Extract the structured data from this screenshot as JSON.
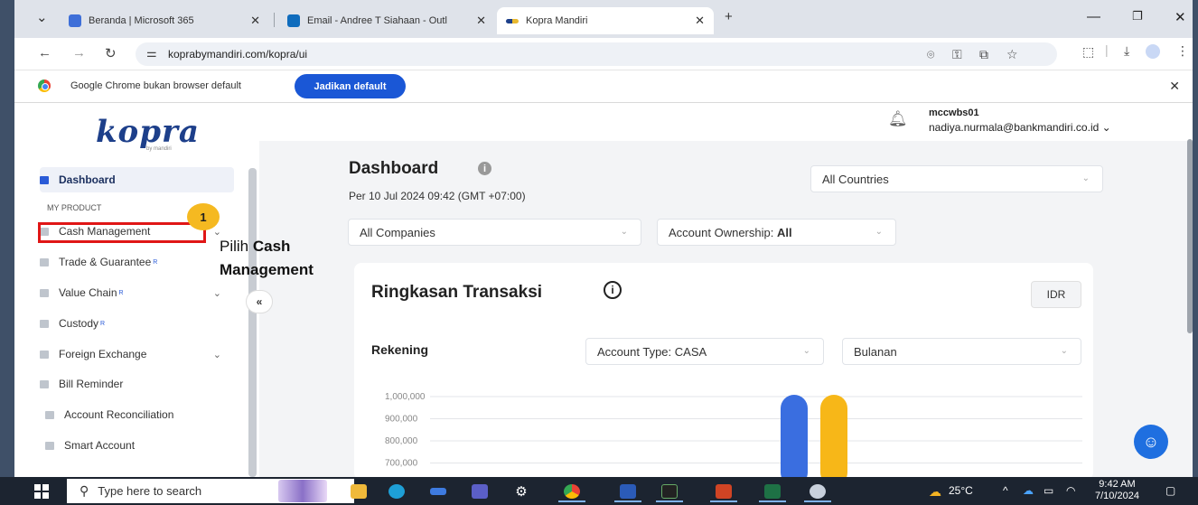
{
  "browser": {
    "tabs": [
      {
        "title": "Beranda | Microsoft 365",
        "icon": "microsoft-365-icon",
        "color": "#3e6fd8"
      },
      {
        "title": "Email - Andree T Siahaan - Outl",
        "icon": "outlook-icon",
        "color": "#0f6cbd"
      },
      {
        "title": "Kopra Mandiri",
        "icon": "kopra-favicon",
        "color": "#e8b830"
      }
    ],
    "url": "koprabymandiri.com/kopra/ui",
    "infobar_message": "Google Chrome bukan browser default",
    "infobar_button": "Jadikan default"
  },
  "app": {
    "logo": "kopra",
    "logo_sub": "by mandiri",
    "user": {
      "id": "mccwbs01",
      "email": "nadiya.nurmala@bankmandiri.co.id"
    },
    "sidebar": {
      "dashboard": "Dashboard",
      "section_label": "MY PRODUCT",
      "items": [
        {
          "label": "Cash Management",
          "badge": "",
          "chevron": true
        },
        {
          "label": "Trade & Guarantee",
          "badge": "R",
          "chevron": false
        },
        {
          "label": "Value Chain",
          "badge": "R",
          "chevron": true
        },
        {
          "label": "Custody",
          "badge": "R",
          "chevron": false
        },
        {
          "label": "Foreign Exchange",
          "badge": "",
          "chevron": true
        },
        {
          "label": "Bill Reminder",
          "badge": "",
          "chevron": false
        },
        {
          "label": "Account Reconciliation",
          "badge": "",
          "chevron": false
        },
        {
          "label": "Smart Account",
          "badge": "",
          "chevron": false
        }
      ],
      "collapse_glyph": "«"
    },
    "annotation": {
      "step_number": "1",
      "text_prefix": "Pilih",
      "text_bold_1": "Cash",
      "text_bold_2": "Management"
    },
    "dashboard": {
      "title": "Dashboard",
      "date": "Per 10 Jul 2024 09:42 (GMT +07:00)",
      "filter_countries": "All Countries",
      "filter_companies": "All Companies",
      "filter_ownership_label": "Account Ownership:",
      "filter_ownership_value": "All"
    },
    "summary": {
      "title": "Ringkasan Transaksi",
      "currency": "IDR",
      "account_label": "Rekening",
      "account_type": "Account Type: CASA",
      "period": "Bulanan"
    }
  },
  "chart_data": {
    "type": "bar",
    "y_ticks": [
      "1,000,000",
      "900,000",
      "800,000",
      "700,000"
    ],
    "ylim_visible": [
      700000,
      1000000
    ],
    "series": [
      {
        "color": "#3a6ee0",
        "values": [
          1000000
        ]
      },
      {
        "color": "#f7b718",
        "values": [
          1000000
        ]
      }
    ]
  },
  "taskbar": {
    "search_placeholder": "Type here to search",
    "weather": "25°C",
    "time": "9:42 AM",
    "date": "7/10/2024"
  }
}
